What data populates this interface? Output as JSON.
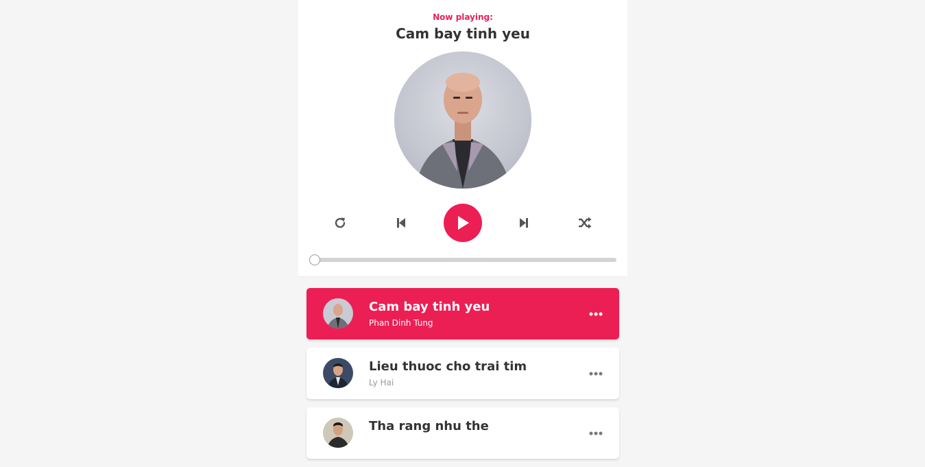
{
  "header": {
    "now_playing_label": "Now playing:",
    "current_title": "Cam bay tinh yeu"
  },
  "controls": {
    "repeat": "repeat-icon",
    "prev": "step-backward-icon",
    "play": "play-icon",
    "next": "step-forward-icon",
    "random": "random-icon"
  },
  "progress": {
    "value": 0
  },
  "playlist": [
    {
      "title": "Cam bay tinh yeu",
      "author": "Phan Dinh Tung",
      "active": true
    },
    {
      "title": "Lieu thuoc cho trai tim",
      "author": "Ly Hai",
      "active": false
    },
    {
      "title": "Tha rang nhu the",
      "author": "",
      "active": false
    }
  ],
  "colors": {
    "accent": "#ec1f55",
    "background": "#f5f5f5",
    "text": "#333333",
    "muted": "#999999"
  }
}
